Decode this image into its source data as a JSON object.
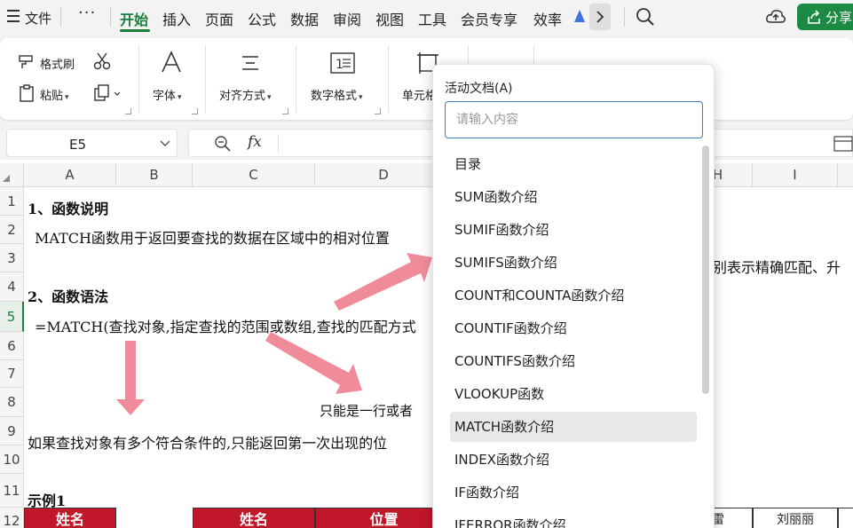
{
  "menu": {
    "file": "文件",
    "more": "···",
    "tabs": [
      "开始",
      "插入",
      "页面",
      "公式",
      "数据",
      "审阅",
      "视图",
      "工具",
      "会员专享",
      "效率"
    ],
    "share": "分享"
  },
  "ribbon": {
    "format_painter": "格式刷",
    "paste": "粘贴",
    "font": "字体",
    "align": "对齐方式",
    "number_format": "数字格式",
    "cell": "单元格"
  },
  "formula_bar": {
    "name_box": "E5",
    "fx": "fx"
  },
  "grid": {
    "columns": [
      "A",
      "B",
      "C",
      "D",
      "H",
      "I"
    ],
    "rows": [
      "1",
      "2",
      "3",
      "4",
      "5",
      "6",
      "7",
      "8",
      "9",
      "10",
      "11",
      "12"
    ],
    "cells": {
      "r1": "1、函数说明",
      "r2": "MATCH函数用于返回要查找的数据在区域中的相对位置",
      "r3_right": "别表示精确匹配、升",
      "r4": "2、函数语法",
      "r5": "=MATCH(查找对象,指定查找的范围或数组,查找的匹配方式",
      "r8": "只能是一行或者",
      "r9": "如果查找对象有多个符合条件的,只能返回第一次出现的位",
      "r11": "示例1",
      "r12_name_a": "姓名",
      "r12_name_c": "姓名",
      "r12_pos_d": "位置",
      "r12_h": "雷",
      "r12_i": "刘丽丽"
    }
  },
  "dropdown": {
    "title": "活动文档(A)",
    "search_placeholder": "请输入内容",
    "search_value": "",
    "items": [
      "目录",
      "SUM函数介绍",
      "SUMIF函数介绍",
      "SUMIFS函数介绍",
      "COUNT和COUNTA函数介绍",
      "COUNTIF函数介绍",
      "COUNTIFS函数介绍",
      "VLOOKUP函数",
      "MATCH函数介绍",
      "INDEX函数介绍",
      "IF函数介绍",
      "IFERROR函数介绍"
    ],
    "active_index": 8
  },
  "icons": {
    "hamburger": "hamburger-icon",
    "search": "search-icon",
    "cloud": "cloud-upload-icon",
    "share": "share-icon",
    "scissors": "scissors-icon",
    "paste": "clipboard-icon",
    "copy": "copy-icon",
    "font": "font-icon",
    "align": "align-icon",
    "number": "number-format-icon",
    "cell": "cell-icon",
    "zoom": "zoom-icon"
  },
  "colors": {
    "accent": "#1d7f3c",
    "share_bg": "#1d8a43",
    "header_red": "#c0172b",
    "arrow": "#f08c99",
    "search_border": "#3d7fbf"
  }
}
